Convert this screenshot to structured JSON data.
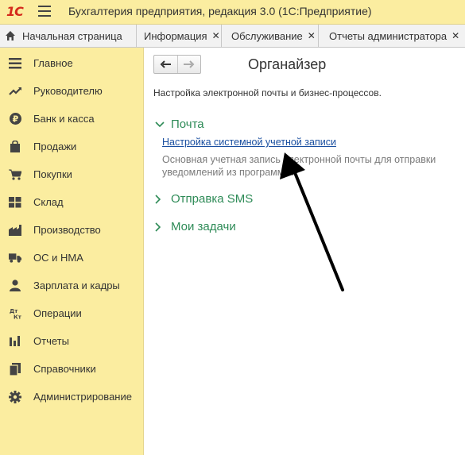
{
  "titlebar": {
    "logo": "1С",
    "app_title": "Бухгалтерия предприятия, редакция 3.0  (1С:Предприятие)"
  },
  "tabs": [
    {
      "label": "Начальная страница",
      "icon": "home-icon"
    },
    {
      "label": "Информация",
      "close": "✕"
    },
    {
      "label": "Обслуживание",
      "close": "✕"
    },
    {
      "label": "Отчеты администратора",
      "close": "✕"
    }
  ],
  "sidebar": {
    "items": [
      {
        "label": "Главное",
        "icon": "list-icon"
      },
      {
        "label": "Руководителю",
        "icon": "trend-icon"
      },
      {
        "label": "Банк и касса",
        "icon": "ruble-icon"
      },
      {
        "label": "Продажи",
        "icon": "bag-icon"
      },
      {
        "label": "Покупки",
        "icon": "cart-icon"
      },
      {
        "label": "Склад",
        "icon": "warehouse-icon"
      },
      {
        "label": "Производство",
        "icon": "factory-icon"
      },
      {
        "label": "ОС и НМА",
        "icon": "truck-icon"
      },
      {
        "label": "Зарплата и кадры",
        "icon": "person-icon"
      },
      {
        "label": "Операции",
        "icon": "dt-kt-icon"
      },
      {
        "label": "Отчеты",
        "icon": "bar-chart-icon"
      },
      {
        "label": "Справочники",
        "icon": "books-icon"
      },
      {
        "label": "Администрирование",
        "icon": "gear-icon"
      }
    ]
  },
  "main": {
    "title": "Органайзер",
    "description": "Настройка электронной почты и бизнес-процессов.",
    "groups": [
      {
        "label": "Почта",
        "expanded": true
      },
      {
        "label": "Отправка SMS",
        "expanded": false
      },
      {
        "label": "Мои задачи",
        "expanded": false
      }
    ],
    "mail_link": "Настройка системной учетной записи",
    "mail_hint": "Основная учетная запись электронной почты для отправки уведомлений из программы."
  },
  "colors": {
    "sidebar_bg": "#fbeda0",
    "group_green": "#2e8b57",
    "link_blue": "#1a4fa0",
    "logo_red": "#d42a1c"
  }
}
